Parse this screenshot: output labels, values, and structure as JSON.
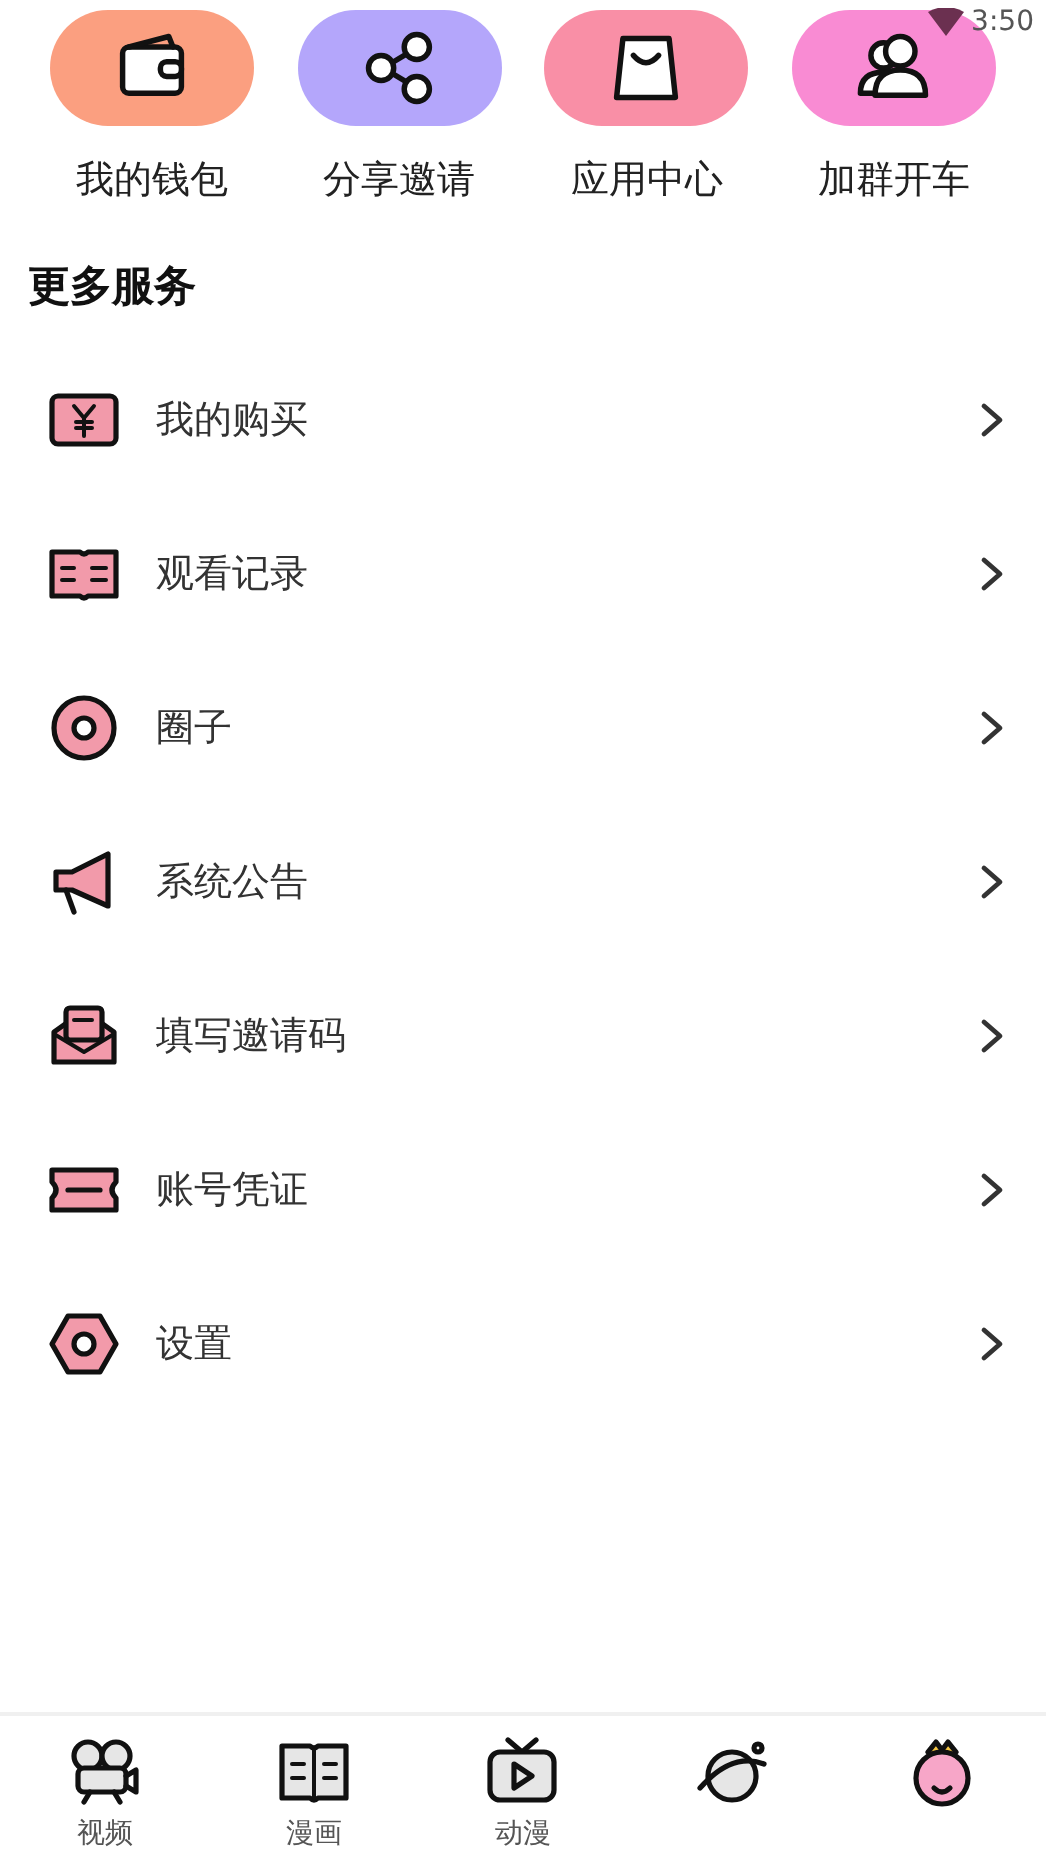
{
  "status_bar": {
    "time": "3:50"
  },
  "shortcuts": [
    {
      "label": "我的钱包",
      "color": "#fb9f80",
      "kind": "wallet"
    },
    {
      "label": "分享邀请",
      "color": "#b4a6fb",
      "kind": "share"
    },
    {
      "label": "应用中心",
      "color": "#f98fa6",
      "kind": "bag"
    },
    {
      "label": "加群开车",
      "color": "#f98bd3",
      "kind": "users"
    }
  ],
  "section_title": "更多服务",
  "services": [
    {
      "label": "我的购买",
      "kind": "yen"
    },
    {
      "label": "观看记录",
      "kind": "book"
    },
    {
      "label": "圈子",
      "kind": "circle"
    },
    {
      "label": "系统公告",
      "kind": "megaphone"
    },
    {
      "label": "填写邀请码",
      "kind": "mail"
    },
    {
      "label": "账号凭证",
      "kind": "ticket"
    },
    {
      "label": "设置",
      "kind": "settings"
    }
  ],
  "tabs": [
    {
      "label": "视频",
      "kind": "camera",
      "selected": false
    },
    {
      "label": "漫画",
      "kind": "book",
      "selected": false
    },
    {
      "label": "动漫",
      "kind": "tv",
      "selected": false
    },
    {
      "kind": "planet",
      "selected": false
    },
    {
      "kind": "face",
      "selected": true
    }
  ]
}
